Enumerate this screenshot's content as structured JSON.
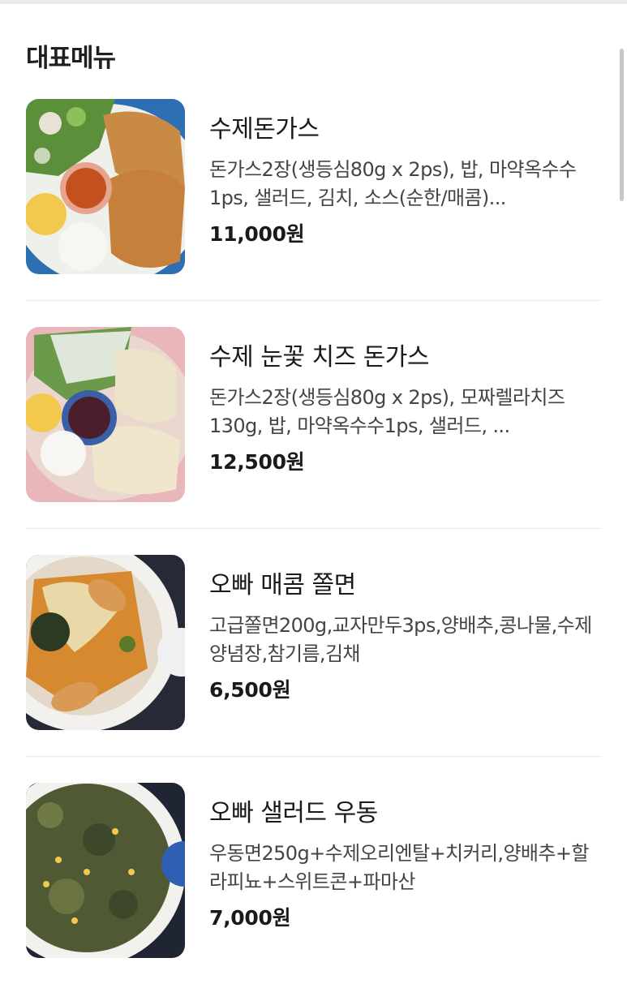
{
  "section": {
    "title": "대표메뉴"
  },
  "menu_items": [
    {
      "name": "수제돈가스",
      "description": "돈가스2장(생등심80g x 2ps), 밥, 마약옥수수1ps, 샐러드, 김치, 소스(순한/매콤)...",
      "price": "11,000원",
      "image": "pork-cutlet-plate-photo"
    },
    {
      "name": "수제 눈꽃 치즈 돈가스",
      "description": "돈가스2장(생등심80g x 2ps), 모짜렐라치즈130g, 밥, 마약옥수수1ps, 샐러드, ...",
      "price": "12,500원",
      "image": "cheese-pork-cutlet-plate-photo"
    },
    {
      "name": "오빠 매콤 쫄면",
      "description": "고급쫄면200g,교자만두3ps,양배추,콩나물,수제양념장,참기름,김채",
      "price": "6,500원",
      "image": "spicy-jjolmyeon-bowl-photo"
    },
    {
      "name": "오빠 샐러드 우동",
      "description": "우동면250g+수제오리엔탈+치커리,양배추+할라피뇨+스위트콘+파마산",
      "price": "7,000원",
      "image": "salad-udon-bowl-photo"
    }
  ],
  "colors": {
    "background": "#ffffff",
    "divider": "#ececec",
    "text_primary": "#1a1a1a",
    "text_secondary": "#444444"
  }
}
